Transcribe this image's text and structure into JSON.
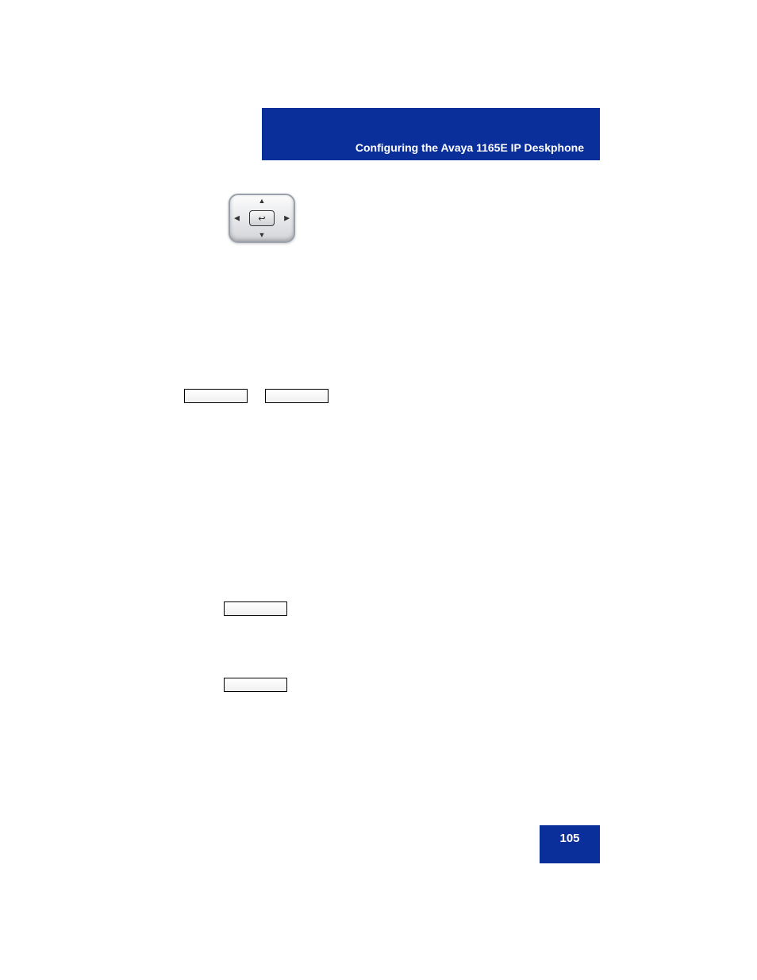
{
  "header": {
    "title": "Configuring the Avaya 1165E IP Deskphone"
  },
  "footer": {
    "page_number": "105"
  }
}
